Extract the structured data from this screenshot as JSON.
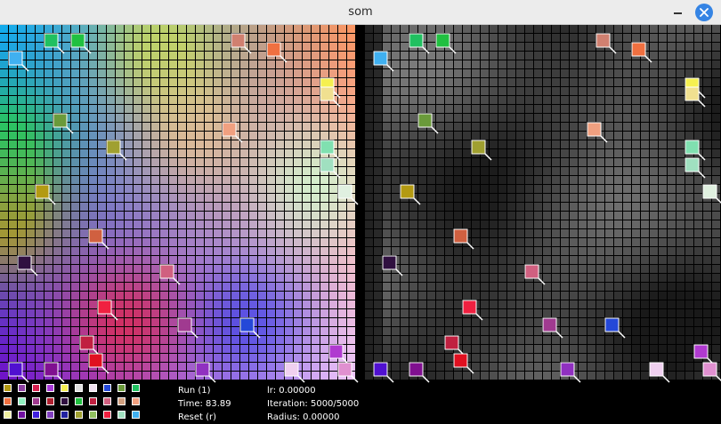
{
  "window": {
    "title": "som"
  },
  "controls": {
    "run_label": "Run (1)",
    "time_label": "Time: 83.89",
    "reset_label": "Reset (r)",
    "lr_label": "lr: 0.00000",
    "iteration_label": "Iteration: 5000/5000",
    "radius_label": "Radius: 0.00000"
  },
  "grid": {
    "columns": 40,
    "rows": 40
  },
  "colors": {
    "close_button": "#3584e4",
    "titlebar": "#ececec",
    "grid_line": "#000000"
  },
  "training_colors": [
    "#b39a12",
    "#8a3ea0",
    "#d62050",
    "#a83ad6",
    "#f5f050",
    "#e0e0e0",
    "#f0e0f0",
    "#2448d8",
    "#6a9a3a",
    "#20c060",
    "#f07040",
    "#90f0c0",
    "#a03a90",
    "#b02030",
    "#301040",
    "#20c040",
    "#c02040",
    "#d06080",
    "#d0a080",
    "#f0a080",
    "#f0f0a0",
    "#7010a0",
    "#4020e0",
    "#8040c0",
    "#2020a0",
    "#a0a030",
    "#90c060",
    "#f02040",
    "#a0e0c0",
    "#40b0f0"
  ],
  "markers": [
    {
      "color": "#40b0f0",
      "col": 1,
      "row": 3
    },
    {
      "color": "#20c060",
      "col": 5,
      "row": 1
    },
    {
      "color": "#20c040",
      "col": 8,
      "row": 1
    },
    {
      "color": "#d08070",
      "col": 26,
      "row": 1
    },
    {
      "color": "#f07040",
      "col": 30,
      "row": 2
    },
    {
      "color": "#f5f050",
      "col": 36,
      "row": 6
    },
    {
      "color": "#f0e090",
      "col": 36,
      "row": 7
    },
    {
      "color": "#6a9a3a",
      "col": 6,
      "row": 10
    },
    {
      "color": "#f0a080",
      "col": 25,
      "row": 11
    },
    {
      "color": "#a0a030",
      "col": 12,
      "row": 13
    },
    {
      "color": "#80e0b0",
      "col": 36,
      "row": 13
    },
    {
      "color": "#a0e0c0",
      "col": 36,
      "row": 15
    },
    {
      "color": "#b39a12",
      "col": 4,
      "row": 18
    },
    {
      "color": "#e0f0e0",
      "col": 38,
      "row": 18
    },
    {
      "color": "#d06040",
      "col": 10,
      "row": 23
    },
    {
      "color": "#301040",
      "col": 2,
      "row": 26
    },
    {
      "color": "#d06080",
      "col": 18,
      "row": 27
    },
    {
      "color": "#f02040",
      "col": 11,
      "row": 31
    },
    {
      "color": "#a03a90",
      "col": 20,
      "row": 33
    },
    {
      "color": "#2448d8",
      "col": 27,
      "row": 33
    },
    {
      "color": "#c02040",
      "col": 9,
      "row": 35
    },
    {
      "color": "#b03ad0",
      "col": 37,
      "row": 36
    },
    {
      "color": "#e01020",
      "col": 10,
      "row": 37
    },
    {
      "color": "#5010d0",
      "col": 1,
      "row": 38
    },
    {
      "color": "#801090",
      "col": 5,
      "row": 38
    },
    {
      "color": "#9030c0",
      "col": 22,
      "row": 38
    },
    {
      "color": "#f0d0f0",
      "col": 32,
      "row": 38
    },
    {
      "color": "#e090d0",
      "col": 38,
      "row": 38
    }
  ]
}
